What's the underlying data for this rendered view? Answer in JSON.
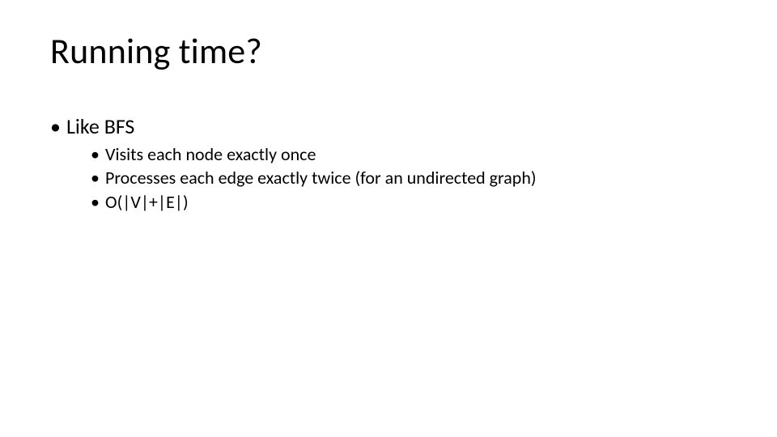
{
  "slide": {
    "title": "Running time?",
    "bullets": [
      {
        "text": "Like BFS",
        "children": [
          "Visits each node exactly once",
          "Processes each edge exactly twice (for an undirected graph)",
          "O(|V|+|E|)"
        ]
      }
    ]
  }
}
